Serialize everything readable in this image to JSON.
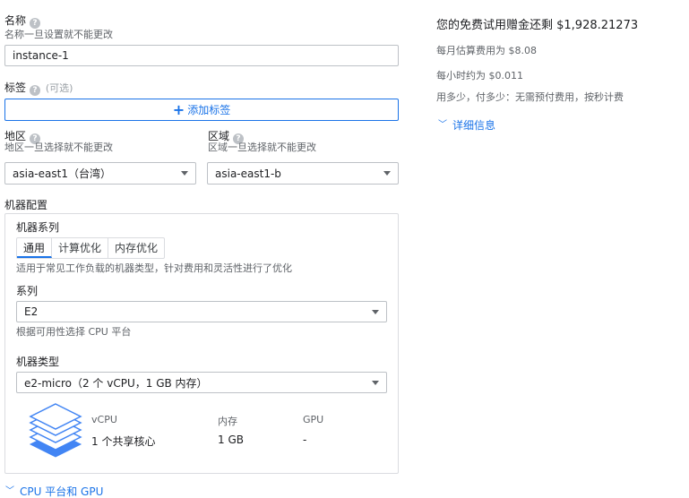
{
  "name": {
    "label": "名称",
    "hint": "名称一旦设置就不能更改",
    "value": "instance-1"
  },
  "labels": {
    "label": "标签",
    "optional": "(可选)",
    "add_button": "添加标签"
  },
  "region": {
    "label": "地区",
    "hint": "地区一旦选择就不能更改",
    "value": "asia-east1（台湾）"
  },
  "zone": {
    "label": "区域",
    "hint": "区域一旦选择就不能更改",
    "value": "asia-east1-b"
  },
  "machine_config": {
    "title": "机器配置",
    "family_label": "机器系列",
    "tabs": [
      "通用",
      "计算优化",
      "内存优化"
    ],
    "active_tab": "通用",
    "family_desc": "适用于常见工作负载的机器类型，针对费用和灵活性进行了优化",
    "series_label": "系列",
    "series_value": "E2",
    "series_hint": "根据可用性选择 CPU 平台",
    "type_label": "机器类型",
    "type_value": "e2-micro（2 个 vCPU，1 GB 内存）",
    "specs": {
      "vcpu_header": "vCPU",
      "vcpu_value": "1 个共享核心",
      "memory_header": "内存",
      "memory_value": "1 GB",
      "gpu_header": "GPU",
      "gpu_value": "-"
    }
  },
  "cpu_gpu_link": "CPU 平台和 GPU",
  "pricing": {
    "title": "您的免费试用赠金还剩 $1,928.21273",
    "monthly": "每月估算费用为 $8.08",
    "hourly": "每小时约为 $0.011",
    "billing": "用多少，付多少：无需预付费用，按秒计费",
    "details_link": "详细信息"
  },
  "colors": {
    "accent": "#1a73e8",
    "stack_icon": "#4285f4"
  },
  "icons": [
    "help-icon",
    "plus-icon",
    "dropdown-caret-icon",
    "double-chevron-down-icon",
    "layers-stack-icon"
  ]
}
